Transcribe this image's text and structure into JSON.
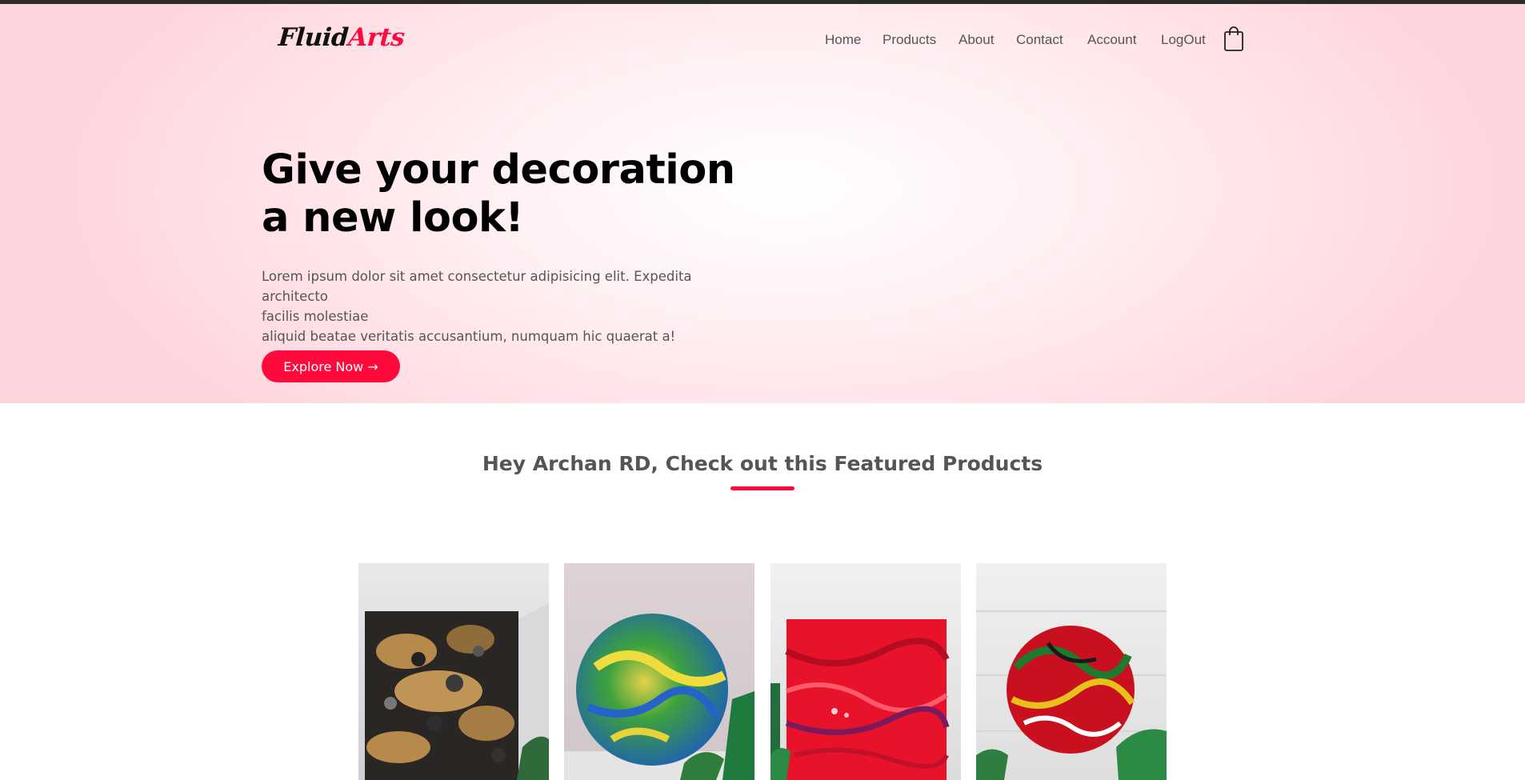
{
  "logo": {
    "part1": "Fluid",
    "part2": "Arts"
  },
  "nav": {
    "items": [
      {
        "label": "Home"
      },
      {
        "label": "Products"
      },
      {
        "label": "About"
      },
      {
        "label": "Contact"
      },
      {
        "label": "Account"
      },
      {
        "label": "LogOut"
      }
    ],
    "cart_icon": "shopping-bag-icon"
  },
  "hero": {
    "headline_line1": "Give your decoration",
    "headline_line2": "a new look!",
    "lead_line1": "Lorem ipsum dolor sit amet consectetur adipisicing elit. Expedita architecto",
    "lead_line2": "facilis molestiae",
    "lead_line3": "aliquid beatae veritatis accusantium, numquam hic quaerat a!",
    "cta_label": "Explore Now →"
  },
  "featured": {
    "title": "Hey Archan RD, Check out this Featured Products",
    "products": [
      {
        "image": "gold-black-pour-canvas"
      },
      {
        "image": "green-blue-yellow-round-pour"
      },
      {
        "image": "red-swirl-square-pour"
      },
      {
        "image": "red-green-yellow-round-pour"
      }
    ]
  },
  "colors": {
    "accent": "#ff0a3c",
    "hero_bg": "#ffd5dd",
    "topbar": "#2b2b2b"
  }
}
